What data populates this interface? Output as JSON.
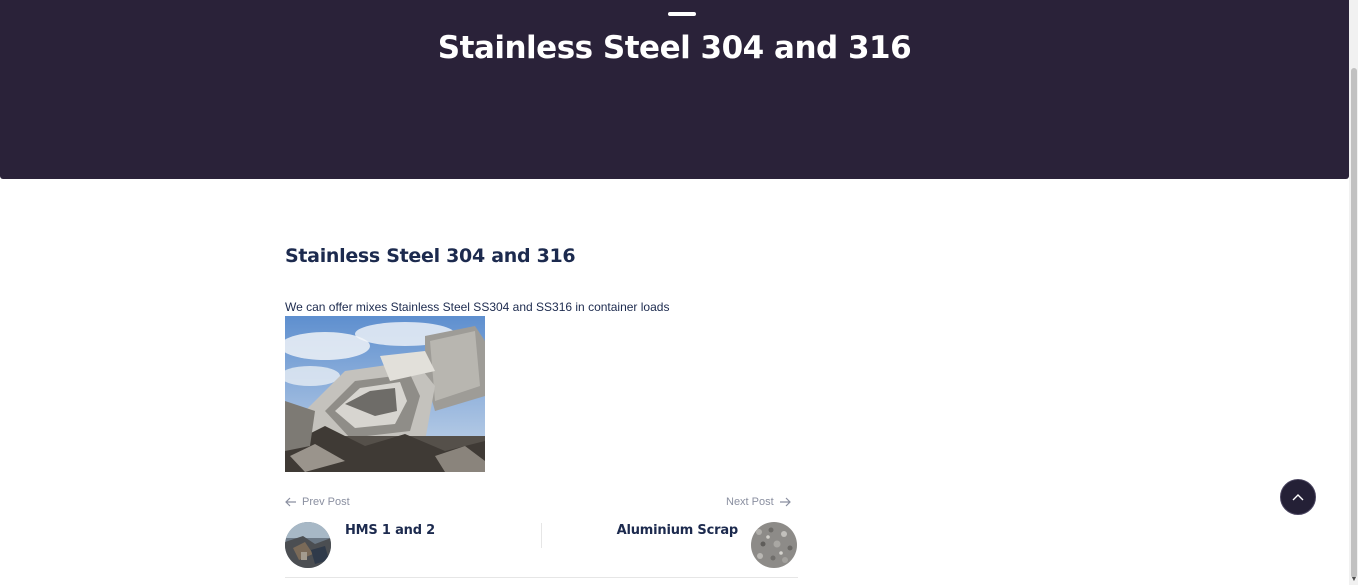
{
  "hero": {
    "title": "Stainless Steel 304 and 316"
  },
  "post": {
    "title": "Stainless Steel 304 and 316",
    "body": "We can offer mixes Stainless Steel SS304 and SS316 in container loads"
  },
  "navigation": {
    "prev_label": "Prev Post",
    "prev_title": "HMS 1 and 2",
    "next_label": "Next Post",
    "next_title": "Aluminium Scrap"
  },
  "colors": {
    "hero_background": "#2a2239",
    "heading": "#1c2a4e",
    "muted": "#8a8fa0"
  },
  "icons": {
    "prev": "arrow-left-icon",
    "next": "arrow-right-icon",
    "to_top": "chevron-up-icon"
  }
}
